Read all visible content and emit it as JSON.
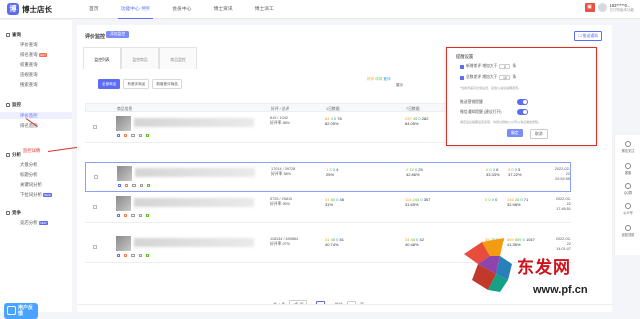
{
  "header": {
    "logo": "博士店长",
    "nav": [
      {
        "label": "首页"
      },
      {
        "label": "功能中心",
        "tag": "NEW"
      },
      {
        "label": "会员中心"
      },
      {
        "label": "博士资讯"
      },
      {
        "label": "博士派工"
      }
    ],
    "user": {
      "name": "183*****0...",
      "sub": "已订购版本功能"
    }
  },
  "sidebar": {
    "sections": [
      {
        "title": "查询",
        "items": [
          "评价查询",
          "排名查询",
          "权重查询",
          "违规查询",
          "搜索查询"
        ]
      },
      {
        "title": "监控",
        "items": [
          "评价监控",
          "排名监控"
        ]
      },
      {
        "title": "分析",
        "items": [
          "大盘分析",
          "标题分析",
          "关键词分析",
          "下拉词分析"
        ]
      },
      {
        "title": "竞争",
        "items": [
          "竞店分析"
        ]
      }
    ],
    "badges": {
      "hot": "HOT",
      "new": "NEW"
    },
    "feedback": "用户反馈"
  },
  "main": {
    "title": "评价监控",
    "pill": "添加监控",
    "push_btn": "☐ 推送通知",
    "tabs": [
      "监控列表",
      "监控商品",
      "商品监控"
    ],
    "filters": [
      "全部商品",
      "有差评商品",
      "新增差评商品"
    ],
    "legend": {
      "good": "好评",
      "mid": "中评",
      "bad": "差评",
      "show": "展示"
    },
    "columns": [
      "商品信息",
      "好评 / 总评",
      "1日数据",
      "7日数据",
      "30日数据",
      "累计数据",
      "加入时间"
    ],
    "rows": [
      {
        "sum1": "819 / 1042",
        "sum2": "好评率 98%",
        "d1": [
          "84",
          "4",
          "0",
          "78"
        ],
        "d1p": "82.05%",
        "d7": [
          "237",
          "45",
          "0",
          "282"
        ],
        "d7p": "84.05%",
        "d30": [],
        "d30p": "",
        "tot": [],
        "totp": "",
        "date1": "",
        "date2": ""
      },
      {
        "sum1": "17014 / 39728",
        "sum2": "好评率 58%",
        "d1": [
          "1",
          "3",
          "0",
          "4"
        ],
        "d1p": "25%",
        "d7": [
          "0",
          "12",
          "0",
          "25"
        ],
        "d7p": "42.86%",
        "d30": [
          "6",
          "0",
          "0",
          "6"
        ],
        "d30p": "33.33%",
        "tot": [
          "5",
          "0",
          "0",
          "5"
        ],
        "totp": "37.22%",
        "date1": "2022-02-22",
        "date2": "02:52:55"
      },
      {
        "sum1": "5725 / 25810",
        "sum2": "好评率 95%",
        "d1": [
          "31",
          "80",
          "0",
          "48"
        ],
        "d1p": "31%",
        "d7": [
          "113",
          "244",
          "0",
          "357"
        ],
        "d7p": "31.65%",
        "d30": [
          "0",
          "0",
          "0",
          "0"
        ],
        "d30p": "",
        "tot": [
          "246",
          "28",
          "0",
          "71"
        ],
        "totp": "32.98%",
        "date1": "2022-02-22",
        "date2": "17:46:51"
      },
      {
        "sum1": "118134 / 459864",
        "sum2": "好评率 97%",
        "d1": [
          "31",
          "46",
          "0",
          "81"
        ],
        "d1p": "40.74%",
        "d7": [
          "34",
          "44",
          "0",
          "42"
        ],
        "d7p": "40.48%",
        "d30": [
          "39",
          "25",
          "0",
          "45"
        ],
        "d30p": "",
        "tot": [
          "569",
          "659",
          "0",
          "1047"
        ],
        "totp": "41.36%",
        "date1": "2022-02-22",
        "date2": "14:01:07"
      }
    ],
    "pager": {
      "total": "共 4 条",
      "size": "4条/页",
      "page": "1",
      "goto": "前往",
      "page_unit": "页",
      "goto_val": "1"
    }
  },
  "popup": {
    "title": "提醒设置",
    "new_bad_label": "新增差评 增加大于",
    "new_bad_val": "0",
    "new_bad_unit": "条",
    "total_bad_label": "总数差评 增加大于",
    "total_bad_val": "10",
    "total_bad_unit": "条",
    "note1": "*当新增差评达到设置，就会以消息提醒卖家。",
    "push_label": "推送营销提醒",
    "wechat_label": "微信通知提醒 (建议打开)",
    "note2": "绑定后台提醒设置选项，将通过微信公众号以消息推送通知。",
    "ok": "确定",
    "cancel": "取消"
  },
  "annotation": "监控详情",
  "right_bar": [
    "微信关注",
    "客服",
    "QQ群",
    "公众号",
    "返回顶部"
  ],
  "watermark": {
    "text": "东发网",
    "url": "www.pf.cn"
  },
  "colors": {
    "accent": "#5b6cf5",
    "annotation": "#d93025",
    "good": "#f0a020",
    "mid": "#52c41a",
    "bad": "#1890ff"
  }
}
